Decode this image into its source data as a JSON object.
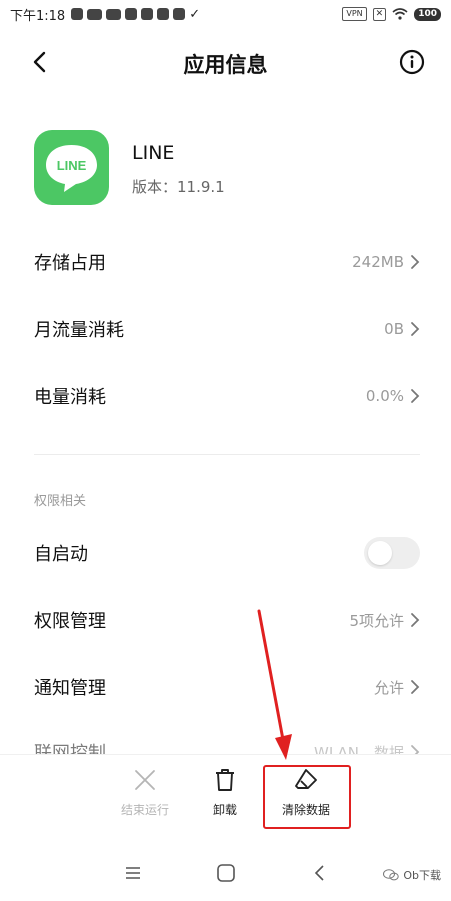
{
  "status_bar": {
    "time": "下午1:18",
    "vpn": "VPN",
    "battery": "100"
  },
  "header": {
    "title": "应用信息"
  },
  "app": {
    "icon_text": "LINE",
    "name": "LINE",
    "version": "版本：11.9.1",
    "icon_color": "#4cc764"
  },
  "rows": {
    "storage": {
      "label": "存储占用",
      "value": "242MB"
    },
    "data_usage": {
      "label": "月流量消耗",
      "value": "0B"
    },
    "battery": {
      "label": "电量消耗",
      "value": "0.0%"
    },
    "permissions_section": "权限相关",
    "autostart": {
      "label": "自启动",
      "enabled": false
    },
    "permission_mgmt": {
      "label": "权限管理",
      "value": "5项允许"
    },
    "notification": {
      "label": "通知管理",
      "value": "允许"
    },
    "network": {
      "label": "联网控制",
      "value": "WLAN、数据"
    }
  },
  "actions": {
    "force_stop": "结束运行",
    "uninstall": "卸载",
    "clear_data": "清除数据"
  },
  "annotation_color": "#e02020",
  "watermark": "Ob下载"
}
